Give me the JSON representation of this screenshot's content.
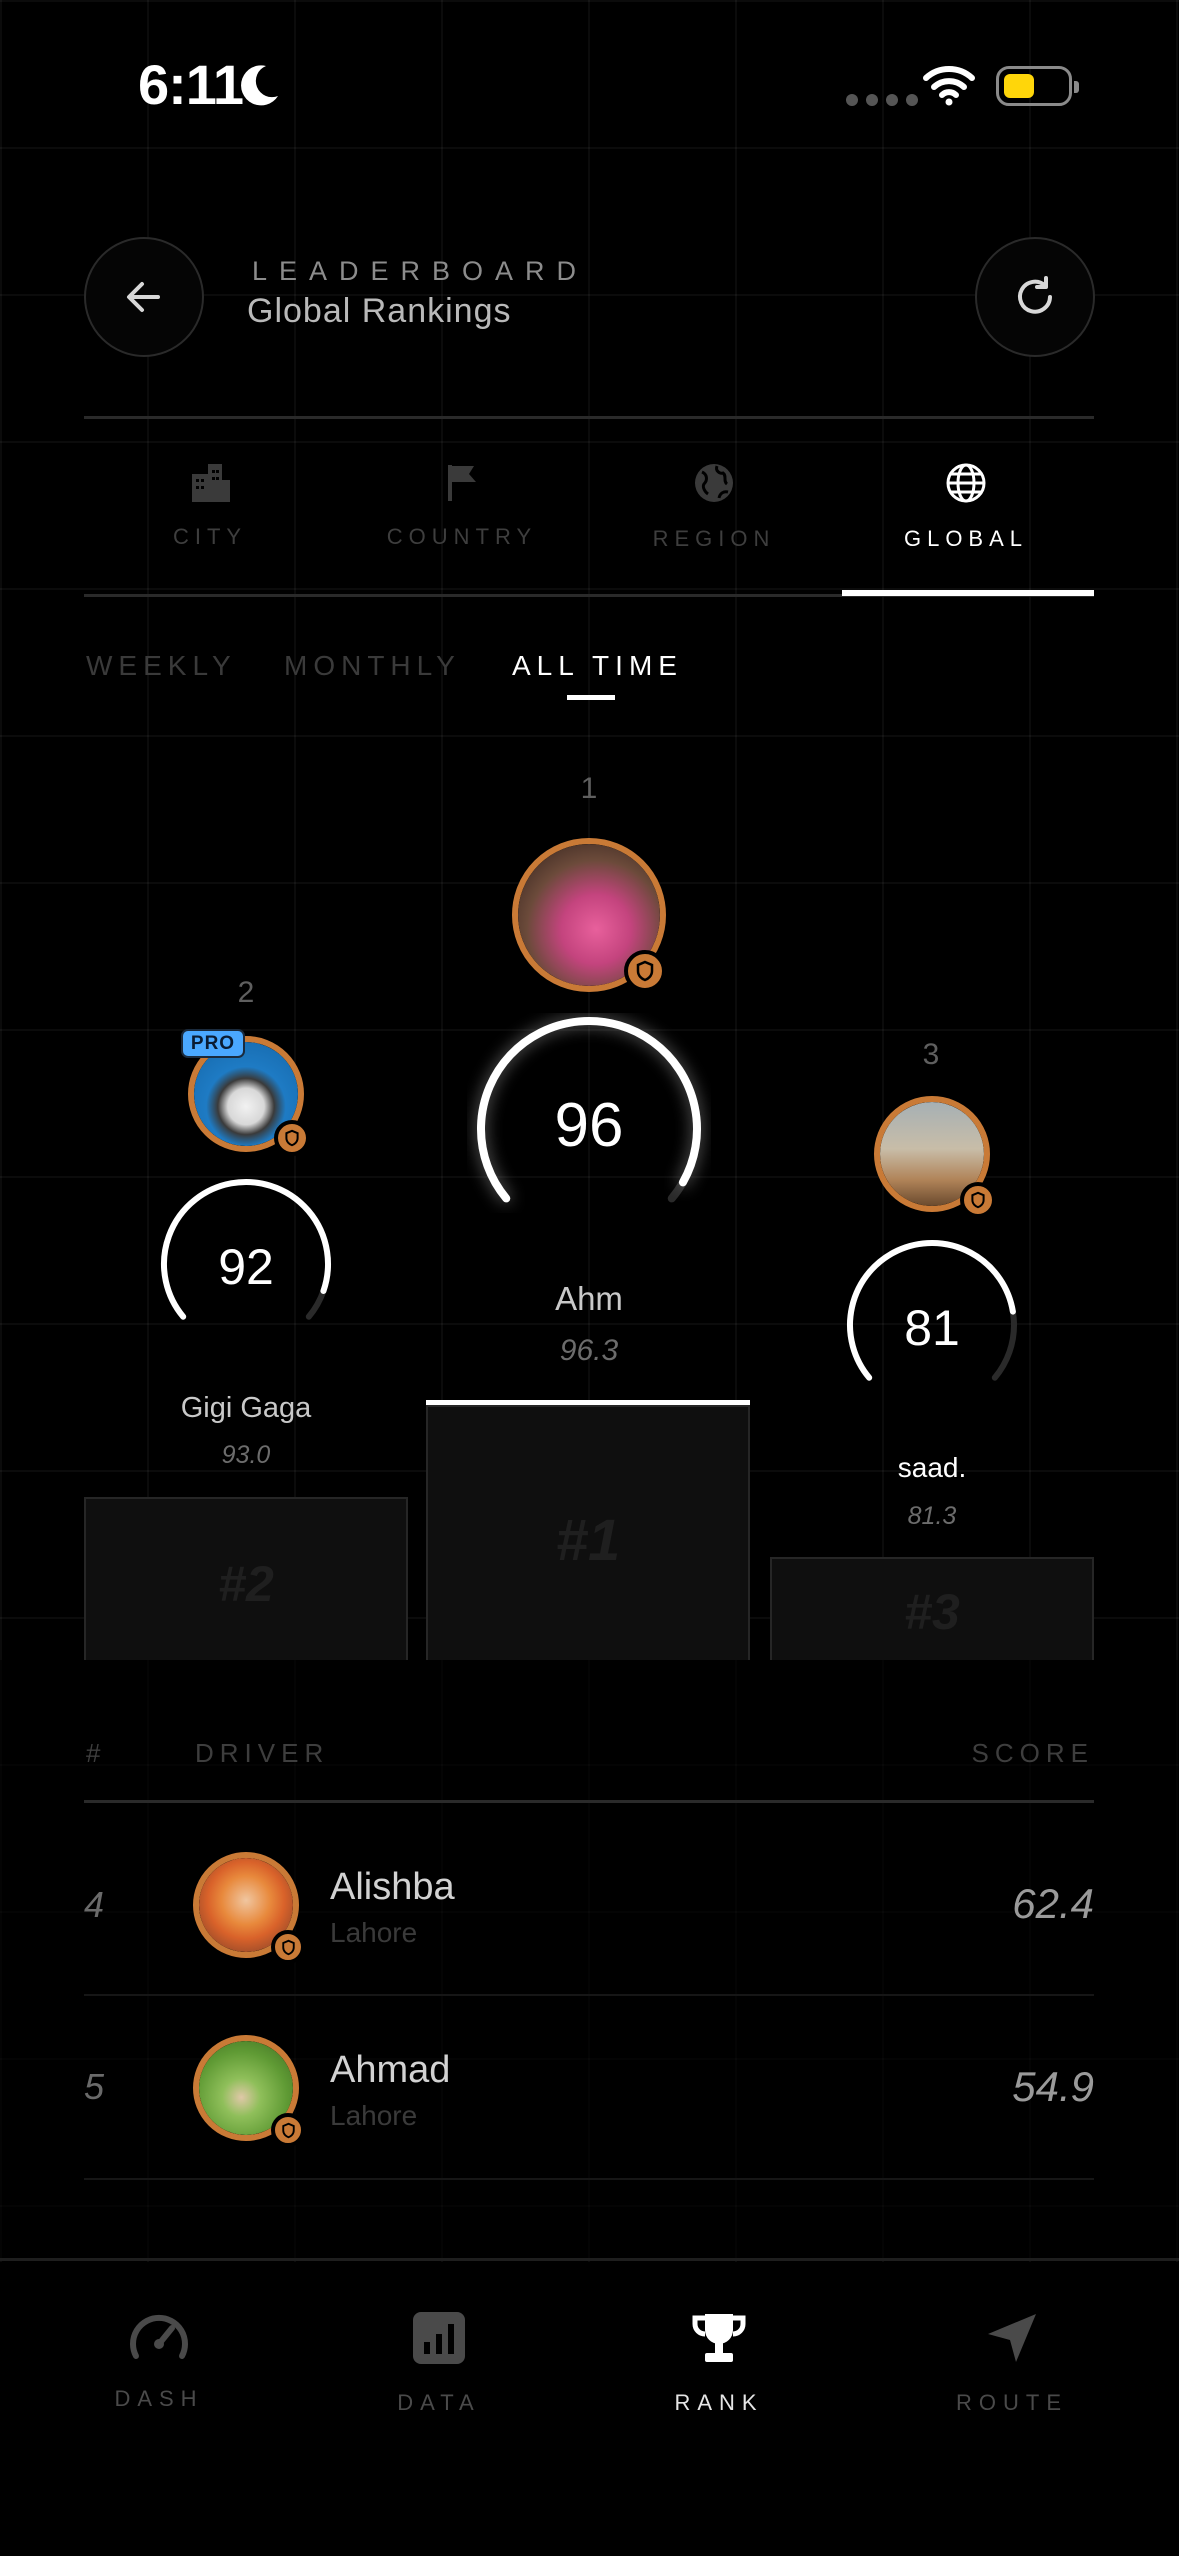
{
  "status_bar": {
    "time": "6:11"
  },
  "header": {
    "eyebrow": "LEADERBOARD",
    "title": "Global Rankings"
  },
  "scope_tabs": [
    {
      "label": "CITY",
      "icon": "city-icon",
      "active": false
    },
    {
      "label": "COUNTRY",
      "icon": "flag-icon",
      "active": false
    },
    {
      "label": "REGION",
      "icon": "earth-icon",
      "active": false
    },
    {
      "label": "GLOBAL",
      "icon": "globe-icon",
      "active": true
    }
  ],
  "period_tabs": [
    {
      "label": "WEEKLY",
      "active": false
    },
    {
      "label": "MONTHLY",
      "active": false
    },
    {
      "label": "ALL TIME",
      "active": true
    }
  ],
  "podium": {
    "first": {
      "rank": "1",
      "score": "96",
      "gauge_fraction": 0.96,
      "name": "Ahm",
      "avg": "96.3",
      "block": "#1"
    },
    "second": {
      "rank": "2",
      "score": "92",
      "gauge_fraction": 0.92,
      "name": "Gigi Gaga",
      "avg": "93.0",
      "block": "#2",
      "badge": "PRO"
    },
    "third": {
      "rank": "3",
      "score": "81",
      "gauge_fraction": 0.81,
      "name": "saad.",
      "avg": "81.3",
      "block": "#3"
    }
  },
  "table": {
    "headers": {
      "rank": "#",
      "driver": "DRIVER",
      "score": "SCORE"
    },
    "rows": [
      {
        "rank": "4",
        "name": "Alishba",
        "city": "Lahore",
        "score": "62.4"
      },
      {
        "rank": "5",
        "name": "Ahmad",
        "city": "Lahore",
        "score": "54.9"
      }
    ]
  },
  "bottom_nav": [
    {
      "label": "DASH",
      "icon": "speedometer-icon",
      "active": false
    },
    {
      "label": "DATA",
      "icon": "bar-chart-icon",
      "active": false
    },
    {
      "label": "RANK",
      "icon": "trophy-icon",
      "active": true
    },
    {
      "label": "ROUTE",
      "icon": "navigation-arrow-icon",
      "active": false
    }
  ],
  "colors": {
    "accent_ring": "#c97a36",
    "pro_badge": "#4aa8ff",
    "battery": "#ffd60a"
  }
}
